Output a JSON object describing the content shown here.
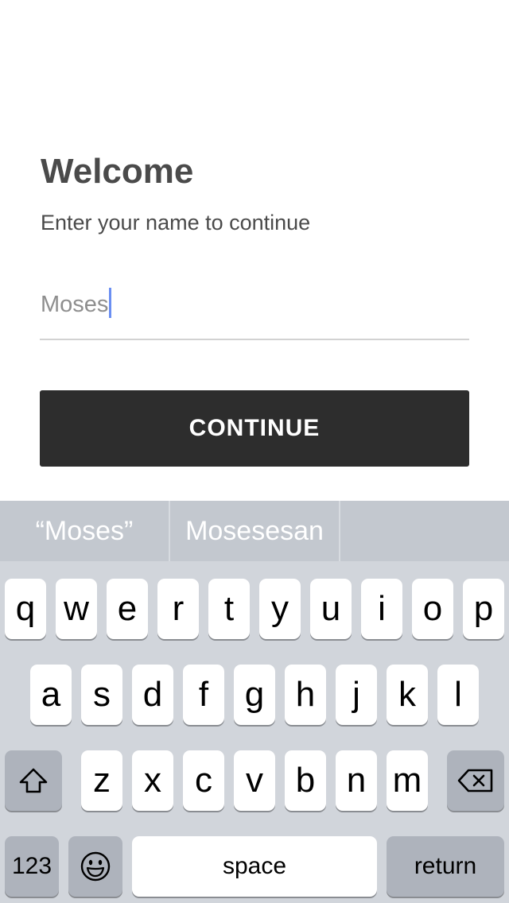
{
  "app": {
    "title": "Welcome",
    "subtitle": "Enter your name to continue",
    "name_field": {
      "value": "Moses"
    },
    "continue_label": "CONTINUE"
  },
  "keyboard": {
    "suggestions": [
      "“Moses”",
      "Mosesesan",
      ""
    ],
    "row1": [
      "q",
      "w",
      "e",
      "r",
      "t",
      "y",
      "u",
      "i",
      "o",
      "p"
    ],
    "row2": [
      "a",
      "s",
      "d",
      "f",
      "g",
      "h",
      "j",
      "k",
      "l"
    ],
    "row3": [
      "z",
      "x",
      "c",
      "v",
      "b",
      "n",
      "m"
    ],
    "numbers_label": "123",
    "space_label": "space",
    "return_label": "return",
    "shift_icon": "shift-icon",
    "delete_icon": "backspace-icon",
    "emoji_icon": "emoji-icon"
  },
  "colors": {
    "button_bg": "#2d2d2d",
    "caret": "#6b8ff2",
    "keyboard_bg": "#d1d5db",
    "suggestion_bg": "#c3c8cf"
  }
}
